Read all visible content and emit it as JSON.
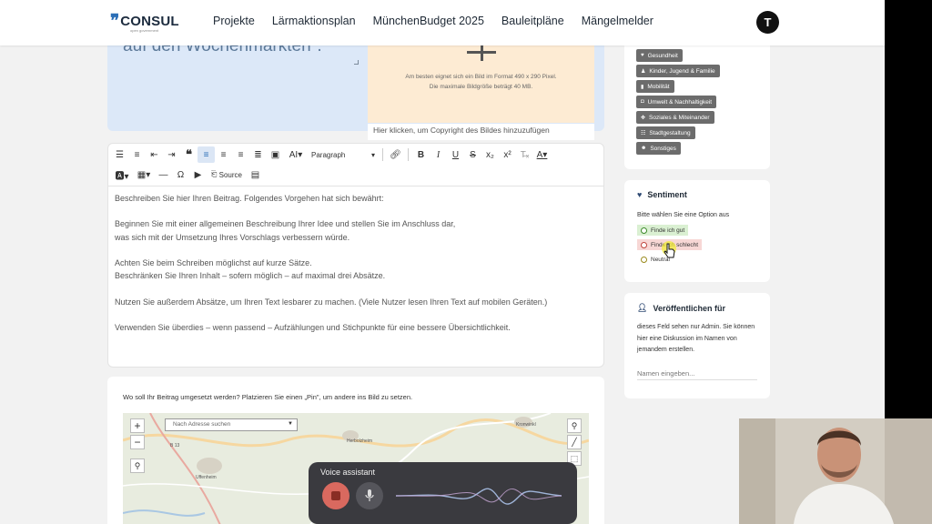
{
  "nav": {
    "logo_mark": "❞",
    "logo_text": "CONSUL",
    "logo_subtext": "open government",
    "links": [
      "Projekte",
      "Lärmaktionsplan",
      "MünchenBudget 2025",
      "Bauleitpläne",
      "Mängelmelder"
    ],
    "avatar_letter": "T"
  },
  "hero": {
    "partial_text": "auf den Wochenmärkten\".",
    "upload_hint_line1": "Am besten eignet sich ein Bild im Format 490 x 290 Pixel.",
    "upload_hint_line2": "Die maximale Bildgröße beträgt 40 MB.",
    "copyright_placeholder": "Hier klicken, um Copyright des Bildes hinzuzufügen"
  },
  "editor": {
    "toolbar": {
      "paragraph_select": "Paragraph",
      "source_label": "Source"
    },
    "paragraphs": [
      "Beschreiben Sie hier Ihren Beitrag. Folgendes Vorgehen hat sich bewährt:",
      "Beginnen Sie mit einer allgemeinen Beschreibung Ihrer Idee und stellen Sie im Anschluss dar,\nwas sich mit der Umsetzung Ihres Vorschlags verbessern würde.",
      "Achten Sie beim Schreiben möglichst auf kurze Sätze.\nBeschränken Sie Ihren Inhalt – sofern möglich – auf maximal drei Absätze.",
      "Nutzen Sie außerdem Absätze, um Ihren Text lesbarer zu machen. (Viele Nutzer lesen Ihren Text auf mobilen Geräten.)",
      "Verwenden Sie überdies – wenn passend – Aufzählungen und Stichpunkte für eine bessere Übersichtlichkeit."
    ]
  },
  "map": {
    "question": "Wo soll Ihr Beitrag umgesetzt werden? Platzieren Sie einen „Pin\", um andere ins Bild zu setzen.",
    "search_placeholder": "Nach Adresse suchen",
    "zoom_in": "+",
    "zoom_out": "−",
    "place_labels": [
      "Kronwinkl",
      "Herbolzheim",
      "Uffenheim",
      "B 13"
    ]
  },
  "voice_assistant": {
    "title": "Voice assistant"
  },
  "categories": {
    "tags": [
      {
        "label": "Gesundheit",
        "icon": "heart-icon"
      },
      {
        "label": "Kinder, Jugend & Familie",
        "icon": "child-icon"
      },
      {
        "label": "Mobilität",
        "icon": "bus-icon"
      },
      {
        "label": "Umwelt & Nachhaltigkeit",
        "icon": "car-icon"
      },
      {
        "label": "Soziales & Miteinander",
        "icon": "hands-icon"
      },
      {
        "label": "Stadtgestaltung",
        "icon": "city-icon"
      },
      {
        "label": "Sonstiges",
        "icon": "user-icon"
      }
    ]
  },
  "sentiment": {
    "title": "Sentiment",
    "hint": "Bitte wählen Sie eine Option aus",
    "options": [
      "Finde ich gut",
      "Finde ich schlecht",
      "Neutral"
    ]
  },
  "publish": {
    "title": "Veröffentlichen für",
    "text": "dieses Feld sehen nur Admin. Sie können hier eine Diskussion im Namen von jemandem erstellen.",
    "input_placeholder": "Namen eingeben..."
  }
}
